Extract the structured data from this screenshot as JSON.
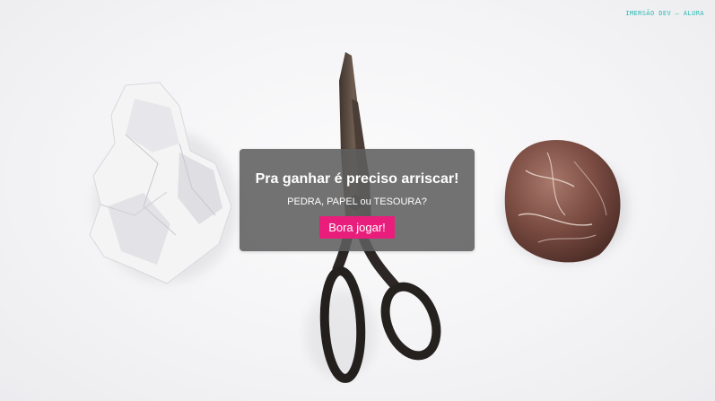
{
  "brand": {
    "text": "IMERSÃO DEV – ALURA"
  },
  "overlay": {
    "title": "Pra ganhar é preciso arriscar!",
    "subtitle": "PEDRA, PAPEL ou TESOURA?",
    "play_button_label": "Bora jogar!"
  },
  "colors": {
    "accent": "#e91e7c",
    "brand": "#2bb8b3",
    "overlay_bg": "#5f5f5f"
  },
  "scene_items": [
    "paper-crumpled-image",
    "scissors-image",
    "rock-image"
  ]
}
